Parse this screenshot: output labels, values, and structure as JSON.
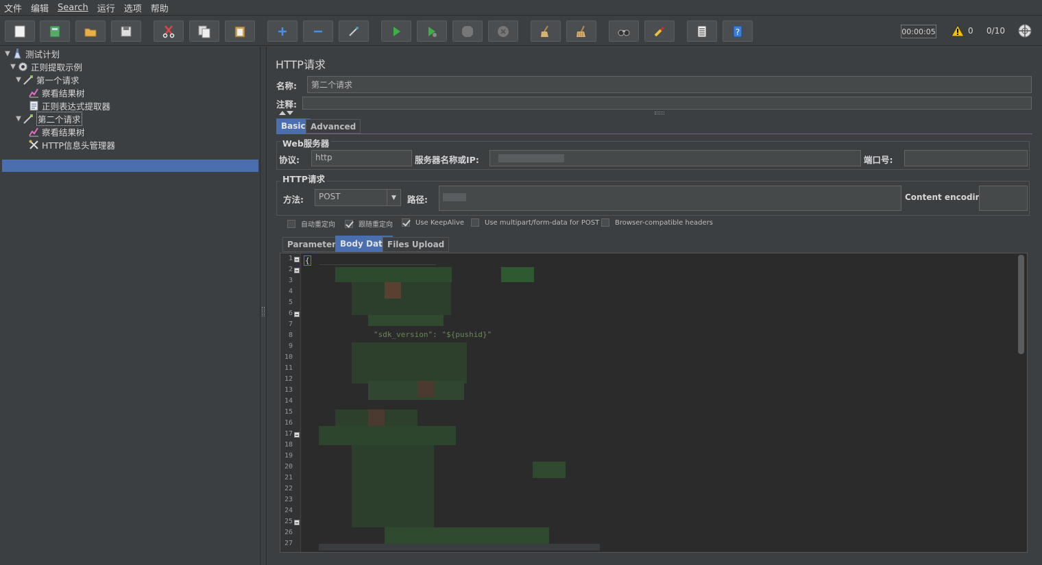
{
  "menu": {
    "items": [
      "文件",
      "编辑",
      "Search",
      "运行",
      "选项",
      "帮助"
    ]
  },
  "toolbar": {
    "buttons": [
      {
        "name": "new",
        "icon": "new-file-icon"
      },
      {
        "name": "templates",
        "icon": "templates-icon"
      },
      {
        "name": "open",
        "icon": "open-folder-icon"
      },
      {
        "name": "save",
        "icon": "save-icon"
      },
      {
        "name": "cut",
        "icon": "scissors-icon"
      },
      {
        "name": "copy",
        "icon": "copy-icon"
      },
      {
        "name": "paste",
        "icon": "paste-icon"
      },
      {
        "name": "expand",
        "icon": "plus-icon"
      },
      {
        "name": "collapse",
        "icon": "minus-icon"
      },
      {
        "name": "toggle",
        "icon": "wand-icon"
      },
      {
        "name": "start",
        "icon": "play-icon"
      },
      {
        "name": "start-no-pause",
        "icon": "play-nopause-icon"
      },
      {
        "name": "stop",
        "icon": "stop-icon"
      },
      {
        "name": "shutdown",
        "icon": "shutdown-icon"
      },
      {
        "name": "clear",
        "icon": "broom-icon"
      },
      {
        "name": "clear-all",
        "icon": "broom-all-icon"
      },
      {
        "name": "search",
        "icon": "binoculars-icon"
      },
      {
        "name": "reset-search",
        "icon": "brush-icon"
      },
      {
        "name": "function-helper",
        "icon": "list-icon"
      },
      {
        "name": "help",
        "icon": "help-icon"
      }
    ],
    "timer": "00:00:05",
    "warnings": "0",
    "threads": "0/10"
  },
  "tree": {
    "nodes": [
      {
        "label": "测试计划",
        "icon": "test-plan-icon",
        "level": 0,
        "expanded": true
      },
      {
        "label": "正则提取示例",
        "icon": "gear-icon",
        "level": 1,
        "expanded": true
      },
      {
        "label": "第一个请求",
        "icon": "sampler-icon",
        "level": 2,
        "expanded": true
      },
      {
        "label": "察看结果树",
        "icon": "graph-icon",
        "level": 3
      },
      {
        "label": "正则表达式提取器",
        "icon": "document-icon",
        "level": 3
      },
      {
        "label": "第二个请求",
        "icon": "sampler-icon",
        "level": 2,
        "expanded": true,
        "selected": true
      },
      {
        "label": "察看结果树",
        "icon": "graph-icon",
        "level": 3
      },
      {
        "label": "HTTP信息头管理器",
        "icon": "tools-icon",
        "level": 3
      }
    ]
  },
  "panel": {
    "title": "HTTP请求",
    "name_label": "名称:",
    "name_value": "第二个请求",
    "comment_label": "注释:",
    "tabs": [
      "Basic",
      "Advanced"
    ],
    "web_server": {
      "title": "Web服务器",
      "protocol_label": "协议:",
      "protocol_value": "http",
      "server_label": "服务器名称或IP:",
      "port_label": "端口号:"
    },
    "http_request": {
      "title": "HTTP请求",
      "method_label": "方法:",
      "method_value": "POST",
      "path_label": "路径:",
      "encoding_label": "Content encoding:"
    },
    "checkboxes": [
      {
        "label": "自动重定向",
        "checked": false
      },
      {
        "label": "跟随重定向",
        "checked": true
      },
      {
        "label": "Use KeepAlive",
        "checked": true
      },
      {
        "label": "Use multipart/form-data for POST",
        "checked": false
      },
      {
        "label": "Browser-compatible headers",
        "checked": false
      }
    ],
    "body_tabs": [
      "Parameters",
      "Body Data",
      "Files Upload"
    ],
    "body_first_line": "{",
    "body_line_8": "\"sdk_version\": \"${pushid}\"",
    "line_numbers": [
      "1",
      "2",
      "3",
      "4",
      "5",
      "6",
      "7",
      "8",
      "9",
      "10",
      "11",
      "12",
      "13",
      "14",
      "15",
      "16",
      "17",
      "18",
      "19",
      "20",
      "21",
      "22",
      "23",
      "24",
      "25",
      "26",
      "27"
    ]
  },
  "colors": {
    "background": "#3c3f41",
    "selection": "#4b6eaf",
    "editor_bg": "#2b2b2b",
    "string_green": "#6a8759"
  }
}
